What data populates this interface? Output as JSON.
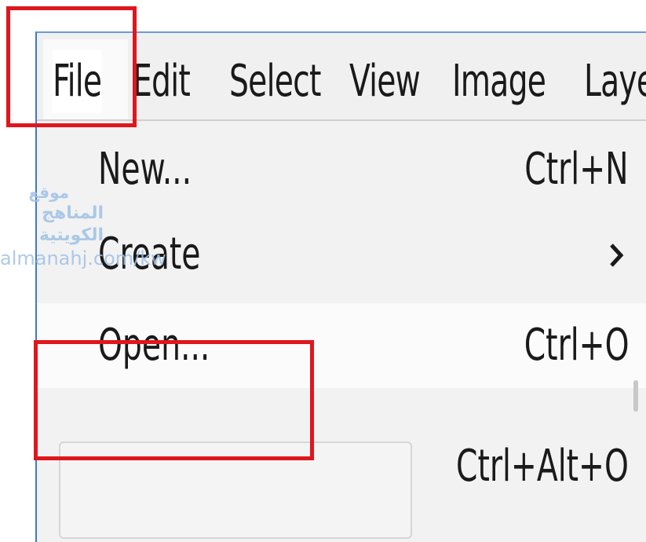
{
  "menubar": {
    "items": [
      {
        "label": "File"
      },
      {
        "label": "Edit"
      },
      {
        "label": "Select"
      },
      {
        "label": "View"
      },
      {
        "label": "Image"
      },
      {
        "label": "Laye"
      }
    ]
  },
  "file_menu": {
    "items": [
      {
        "label": "New...",
        "shortcut": "Ctrl+N"
      },
      {
        "label": "Create",
        "submenu_icon": "chevron-right-icon"
      },
      {
        "label": "Open...",
        "shortcut": "Ctrl+O"
      },
      {
        "label": "",
        "shortcut": "Ctrl+Alt+O"
      }
    ]
  },
  "watermark": {
    "line1": "موقع",
    "line2": "المناهج الكويتية",
    "line3": "almanahj.com/kw"
  },
  "colors": {
    "highlight": "#e0161d",
    "window_border": "#3f79c9",
    "watermark": "#9fc1e6"
  }
}
